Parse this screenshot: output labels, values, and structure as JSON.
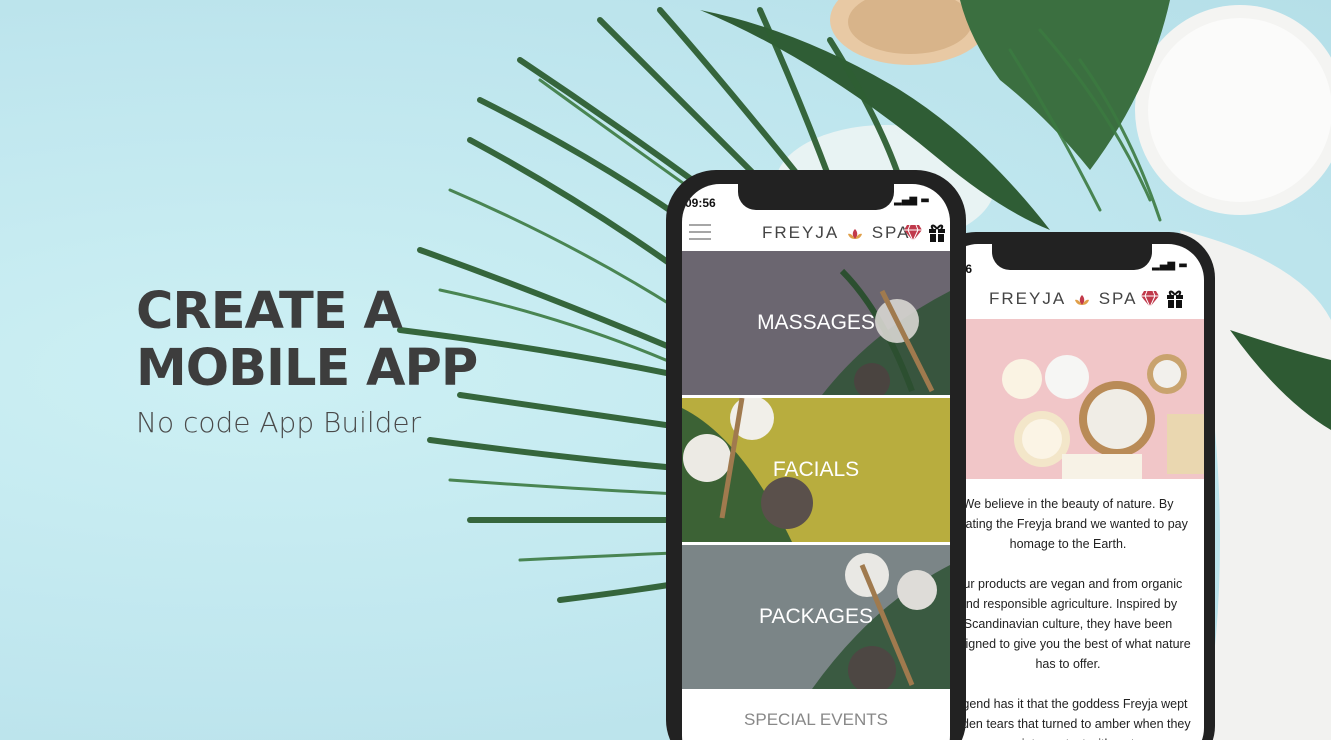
{
  "hero": {
    "line1": "CREATE A",
    "line2": "MOBILE APP",
    "subtitle": "No code App Builder"
  },
  "phone_front": {
    "time": "09:56",
    "brand_left": "FREYJA",
    "brand_right": "SPA",
    "tiles": [
      {
        "label": "MASSAGES"
      },
      {
        "label": "FACIALS"
      },
      {
        "label": "PACKAGES"
      }
    ],
    "special_label": "SPECIAL EVENTS"
  },
  "phone_back": {
    "time": "9:56",
    "brand_left": "FREYJA",
    "brand_right": "SPA",
    "paragraphs": [
      "We believe in the beauty of nature. By creating the Freyja brand we wanted to pay homage to the Earth.",
      "Our products are vegan and from organic and responsible agriculture. Inspired by Scandinavian culture, they have been designed to give you the best of what nature has to offer.",
      "Legend has it that the goddess Freyja wept golden tears that turned to amber when they came into contact with water."
    ]
  },
  "colors": {
    "background": "#c3eaf0",
    "hero_text": "#3d3d3d",
    "facials_tile": "#b9ae3c",
    "massages_tile": "#6f6a70",
    "packages_tile": "#7d8789",
    "gem": "#c0394b"
  },
  "icons": [
    "menu-icon",
    "diamond-icon",
    "gift-icon",
    "lotus-logo-icon",
    "signal-icon",
    "wifi-icon",
    "battery-icon"
  ]
}
